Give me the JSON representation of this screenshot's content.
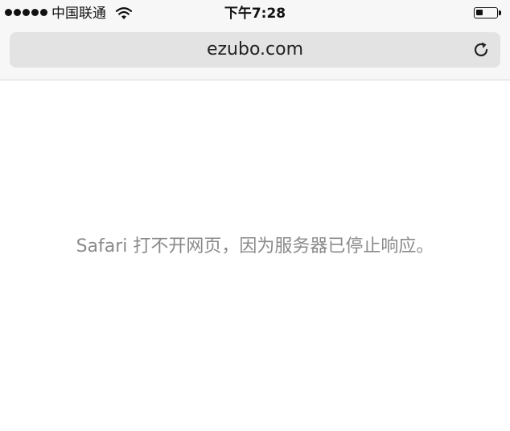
{
  "status_bar": {
    "signal_icon": "signal-dots-icon",
    "signal_strength": 5,
    "carrier": "中国联通",
    "wifi_icon": "wifi-icon",
    "time": "下午7:28",
    "battery_icon": "battery-icon",
    "battery_level": 0.35
  },
  "address_bar": {
    "url": "ezubo.com",
    "reload_icon": "reload-icon"
  },
  "content": {
    "error_message": "Safari 打不开网页，因为服务器已停止响应。"
  }
}
